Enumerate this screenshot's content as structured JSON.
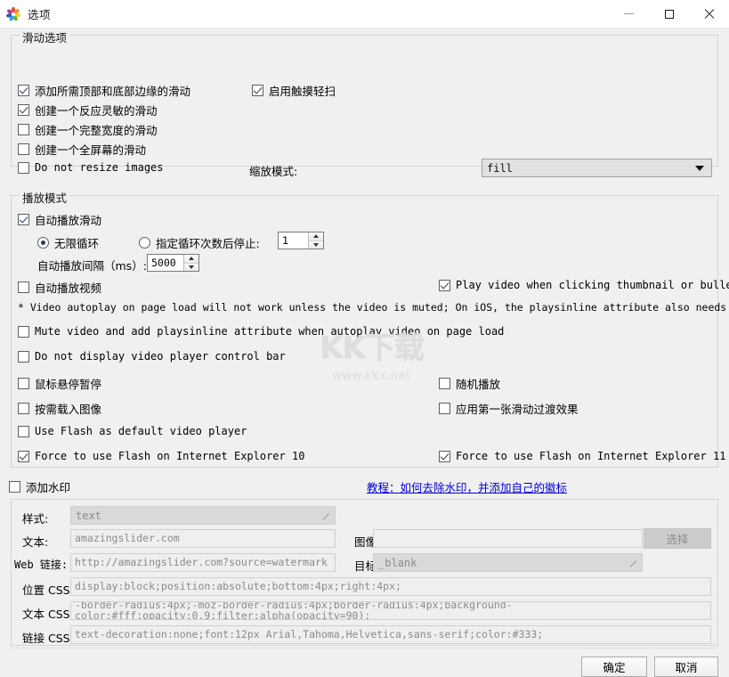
{
  "window": {
    "title": "选项",
    "icon": "app-pinwheel-icon",
    "controls": {
      "minimize": "–",
      "maximize": "□",
      "close": "✕"
    }
  },
  "slide_options": {
    "title": "滑动选项",
    "checkboxes": [
      {
        "label": "添加所需顶部和底部边缘的滑动",
        "checked": true,
        "script": "cn"
      },
      {
        "label": "创建一个反应灵敏的滑动",
        "checked": true,
        "script": "cn"
      },
      {
        "label": "创建一个完整宽度的滑动",
        "checked": false,
        "script": "cn"
      },
      {
        "label": "创建一个全屏幕的滑动",
        "checked": false,
        "script": "cn"
      },
      {
        "label": "Do not resize images",
        "checked": false,
        "script": "mono"
      },
      {
        "label": "启用触摸轻扫",
        "checked": true,
        "script": "cn"
      }
    ],
    "scale_mode_label": "缩放模式:",
    "scale_mode_value": "fill"
  },
  "play_mode": {
    "title": "播放模式",
    "autoplay_slide": {
      "label": "自动播放滑动",
      "checked": true
    },
    "loop_infinite": {
      "label": "无限循环",
      "selected": true
    },
    "loop_count": {
      "label": "指定循环次数后停止:",
      "selected": false,
      "value": "1"
    },
    "interval": {
      "label": "自动播放间隔（ms）:",
      "value": "5000"
    },
    "autoplay_video": {
      "label": "自动播放视频",
      "checked": false
    },
    "play_on_click": {
      "label": "Play video when clicking thumbnail or bullet",
      "checked": true
    },
    "note": "* Video autoplay on page load will not work unless the video is muted; On iOS, the playsinline attribute also needs to be enabled.",
    "mute_video": {
      "label": "Mute video and add playsinline attribute when autoplay video on page load",
      "checked": false
    },
    "hide_controls": {
      "label": "Do not display video player control bar",
      "checked": false
    },
    "pause_on_hover": {
      "label": "鼠标悬停暂停",
      "checked": false
    },
    "random_play": {
      "label": "随机播放",
      "checked": false
    },
    "lazy_load": {
      "label": "按需载入图像",
      "checked": false
    },
    "first_slide_transition": {
      "label": "应用第一张滑动过渡效果",
      "checked": false
    },
    "use_flash": {
      "label": "Use Flash as default video player",
      "checked": false
    },
    "force_flash_ie10": {
      "label": "Force to use Flash on Internet Explorer 10",
      "checked": true
    },
    "force_flash_ie11": {
      "label": "Force to use Flash on Internet Explorer 11",
      "checked": true
    }
  },
  "watermark": {
    "enable": {
      "label": "添加水印",
      "checked": false
    },
    "tutorial_link": "教程：如何去除水印，并添加自己的徽标",
    "style_label": "样式:",
    "style_value": "text",
    "text_label": "文本:",
    "text_value": "amazingslider.com",
    "image_label": "图像:",
    "image_value": "",
    "choose_button": "选择",
    "web_link_label": "Web 链接:",
    "web_link_value": "http://amazingslider.com?source=watermark",
    "target_label": "目标:",
    "target_value": "_blank",
    "position_css_label": "位置 CSS:",
    "position_css_value": "display:block;position:absolute;bottom:4px;right:4px;",
    "text_css_label": "文本 CSS:",
    "text_css_value": "-border-radius:4px;-moz-border-radius:4px;border-radius:4px;background-color:#fff;opacity:0.9;filter:alpha(opacity=90);",
    "link_css_label": "链接 CSS:",
    "link_css_value": "text-decoration:none;font:12px Arial,Tahoma,Helvetica,sans-serif;color:#333;"
  },
  "overlay_watermark": {
    "main": "KK下载",
    "sub": "www.kkx.net"
  },
  "footer": {
    "ok": "确定",
    "cancel": "取消"
  },
  "colors": {
    "background": "#f0f0f0",
    "titlebar": "#ffffff",
    "link": "#0000d8",
    "check": "#2b3a55"
  }
}
